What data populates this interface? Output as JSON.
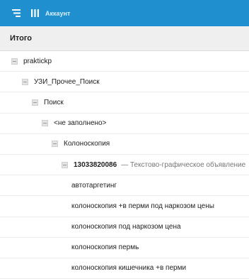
{
  "topbar": {
    "title": "Аккаунт",
    "icons": [
      "menu-icon",
      "columns-icon"
    ],
    "accent_color": "#1f8fcf"
  },
  "table": {
    "header": "Итого",
    "rows": [
      {
        "label": "praktickp"
      },
      {
        "label": "УЗИ_Прочее_Поиск"
      },
      {
        "label": "Поиск"
      },
      {
        "label": "<не заполнено>"
      },
      {
        "label": "Колоноскопия"
      },
      {
        "label": "13033820086",
        "detail": "— Текстово-графическое объявление"
      },
      {
        "label": "автотаргетинг"
      },
      {
        "label": "колоноскопия +в перми под наркозом цены"
      },
      {
        "label": "колоноскопия под наркозом цена"
      },
      {
        "label": "колоноскопия пермь"
      },
      {
        "label": "колоноскопия кишечника +в перми"
      }
    ]
  }
}
